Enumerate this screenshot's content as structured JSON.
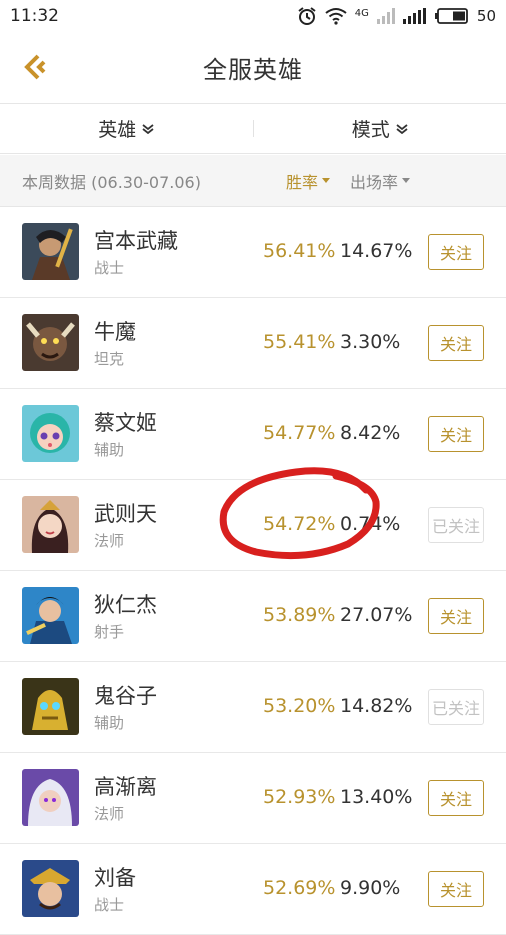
{
  "status": {
    "time": "11:32",
    "battery": "50",
    "network": "4G"
  },
  "nav": {
    "title": "全服英雄"
  },
  "filters": [
    {
      "label": "英雄"
    },
    {
      "label": "模式"
    }
  ],
  "subbar": {
    "week_label": "本周数据 (06.30-07.06)",
    "sort_win": "胜率",
    "sort_pick": "出场率"
  },
  "heroes": [
    {
      "name": "宫本武藏",
      "role": "战士",
      "win_rate": "56.41%",
      "pick_rate": "14.67%",
      "follow": "关注"
    },
    {
      "name": "牛魔",
      "role": "坦克",
      "win_rate": "55.41%",
      "pick_rate": "3.30%",
      "follow": "关注"
    },
    {
      "name": "蔡文姬",
      "role": "辅助",
      "win_rate": "54.77%",
      "pick_rate": "8.42%",
      "follow": "关注"
    },
    {
      "name": "武则天",
      "role": "法师",
      "win_rate": "54.72%",
      "pick_rate": "0.74%",
      "follow": "已关注"
    },
    {
      "name": "狄仁杰",
      "role": "射手",
      "win_rate": "53.89%",
      "pick_rate": "27.07%",
      "follow": "关注"
    },
    {
      "name": "鬼谷子",
      "role": "辅助",
      "win_rate": "53.20%",
      "pick_rate": "14.82%",
      "follow": "已关注"
    },
    {
      "name": "高渐离",
      "role": "法师",
      "win_rate": "52.93%",
      "pick_rate": "13.40%",
      "follow": "关注"
    },
    {
      "name": "刘备",
      "role": "战士",
      "win_rate": "52.69%",
      "pick_rate": "9.90%",
      "follow": "关注"
    }
  ],
  "colors": {
    "accent": "#b8922e",
    "annotation": "#d8201e"
  }
}
